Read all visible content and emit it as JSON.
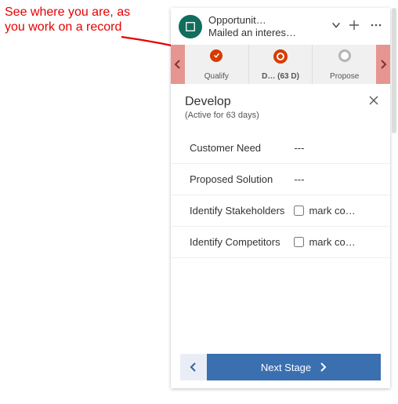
{
  "annotation": {
    "text": "See where you are, as you work on a record"
  },
  "header": {
    "title": "Opportunit…",
    "subtitle": "Mailed an interes…"
  },
  "bpf": {
    "stages": [
      {
        "label": "Qualify",
        "state": "completed"
      },
      {
        "label": "D…  (63 D)",
        "state": "active"
      },
      {
        "label": "Propose",
        "state": "future"
      }
    ]
  },
  "detail": {
    "title": "Develop",
    "subtitle": "(Active for 63 days)"
  },
  "fields": {
    "customer_need": {
      "label": "Customer Need",
      "value": "---"
    },
    "proposed_solution": {
      "label": "Proposed Solution",
      "value": "---"
    },
    "stakeholders": {
      "label": "Identify Stakeholders",
      "checkbox_label": "mark co…"
    },
    "competitors": {
      "label": "Identify Competitors",
      "checkbox_label": "mark co…"
    }
  },
  "footer": {
    "next_label": "Next Stage"
  }
}
